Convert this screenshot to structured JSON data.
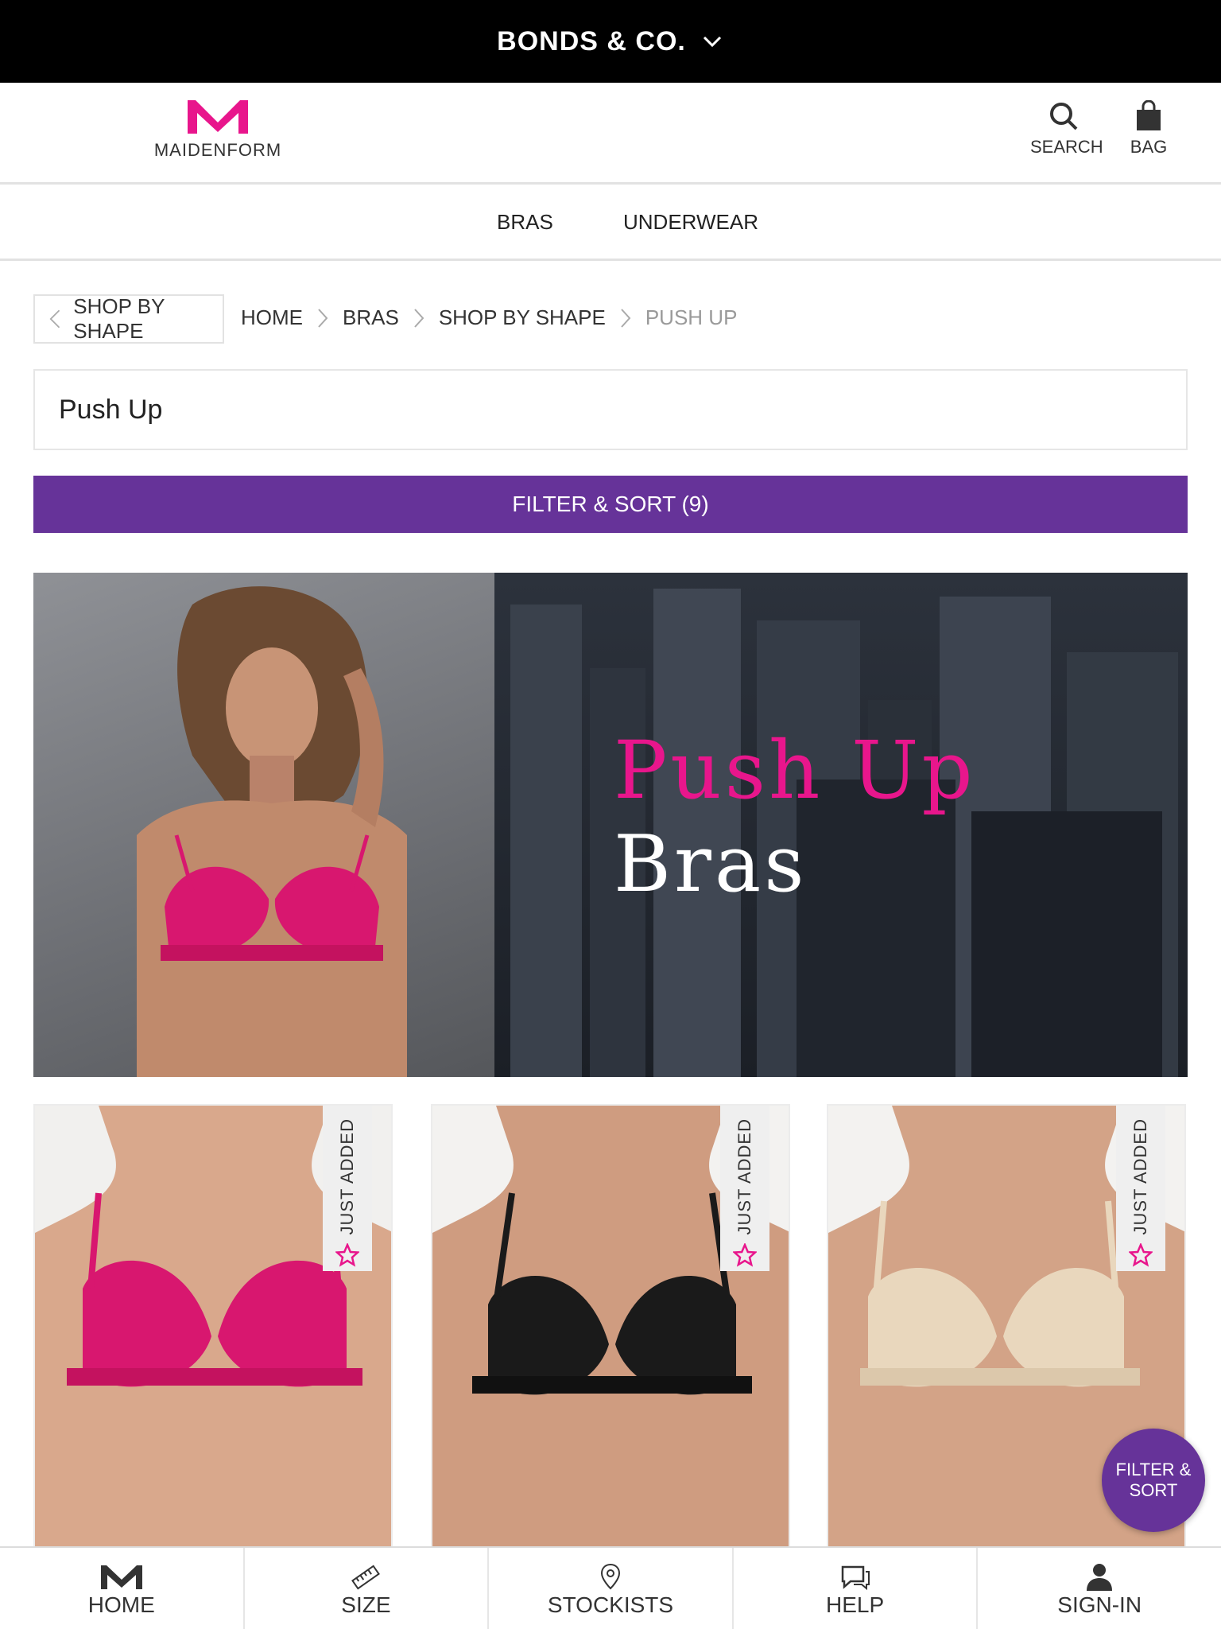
{
  "brand_bar": {
    "label": "BONDS & CO."
  },
  "header": {
    "logo_text": "MAIDENFORM",
    "search_label": "SEARCH",
    "bag_label": "BAG"
  },
  "nav": {
    "items": [
      "BRAS",
      "UNDERWEAR"
    ]
  },
  "breadcrumb": {
    "back_label": "SHOP BY SHAPE",
    "items": [
      "HOME",
      "BRAS",
      "SHOP BY SHAPE",
      "PUSH UP"
    ]
  },
  "page_title": "Push Up",
  "filter_bar_label": "FILTER & SORT (9)",
  "hero": {
    "line1": "Push Up",
    "line2": "Bras"
  },
  "products": [
    {
      "badge": "JUST ADDED",
      "color": "#d8176f"
    },
    {
      "badge": "JUST ADDED",
      "color": "#1a1a1a"
    },
    {
      "badge": "JUST ADDED",
      "color": "#e9d7bd"
    }
  ],
  "fab": {
    "line1": "FILTER &",
    "line2": "SORT"
  },
  "tabbar": {
    "items": [
      "HOME",
      "SIZE",
      "STOCKISTS",
      "HELP",
      "SIGN-IN"
    ]
  },
  "colors": {
    "accent": "#663399",
    "brand_pink": "#e8168c"
  }
}
